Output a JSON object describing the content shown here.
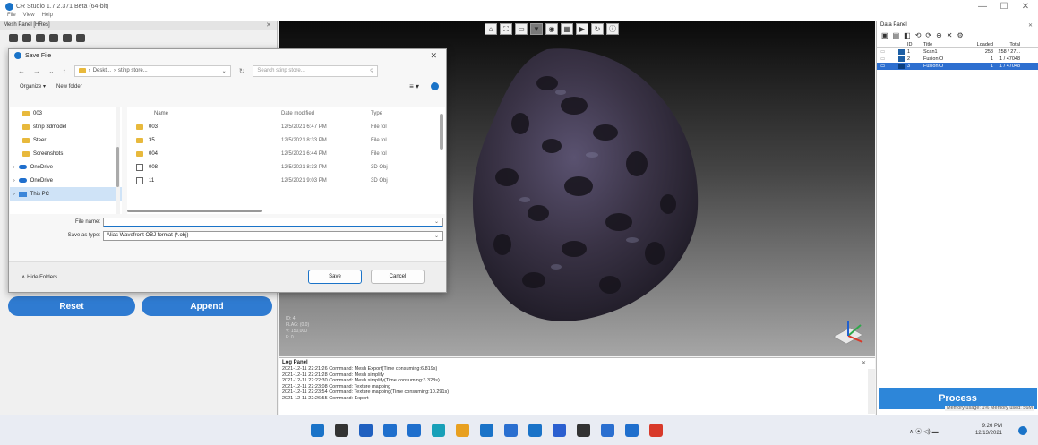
{
  "window": {
    "title": "CR Studio 1.7.2.371 Beta (64-bit)",
    "menu": [
      "File",
      "View",
      "Help"
    ],
    "minimize": "—",
    "maximize": "☐",
    "close": "✕"
  },
  "left_panel": {
    "title": "Mesh Panel [HRes]",
    "close": "✕",
    "reset_label": "Reset",
    "append_label": "Append"
  },
  "viewport": {
    "toolbar": [
      "⌂",
      "⛶",
      "▭",
      "▼",
      "◉",
      "▦",
      "▶",
      "↻",
      "ⓘ"
    ],
    "info_lines": [
      "ID: 4",
      "FLAG: (0.0)",
      "V: 150,000",
      "F: 0"
    ]
  },
  "log_panel": {
    "title": "Log Panel",
    "close": "✕",
    "lines": [
      "2021-12-11 22:21:26 Command: Mesh Export(Time consuming:6.819s)",
      "2021-12-11 22:21:28 Command: Mesh simplify",
      "2021-12-11 22:22:30 Command: Mesh simplify(Time consuming:3.328s)",
      "2021-12-11 22:23:08 Command: Texture mapping",
      "2021-12-11 22:23:54 Command: Texture mapping(Time consuming:10.291s)",
      "2021-12-11 22:26:55 Command: Export"
    ]
  },
  "data_panel": {
    "title": "Data Panel",
    "close": "✕",
    "icons": [
      "▣",
      "▤",
      "◧",
      "⟲",
      "⟳",
      "⊕",
      "✕",
      "⚙"
    ],
    "columns": [
      "ID",
      "Title",
      "Loaded",
      "Total"
    ],
    "rows": [
      {
        "id": "1",
        "title": "Scan1",
        "loaded": "258",
        "total": "258 / 27...",
        "selected": false
      },
      {
        "id": "2",
        "title": "Fusion O",
        "loaded": "1",
        "total": "1 / 47048",
        "selected": false
      },
      {
        "id": "3",
        "title": "Fusion O",
        "loaded": "1",
        "total": "1 / 47048",
        "selected": true
      }
    ],
    "process_label": "Process"
  },
  "dialog": {
    "title": "Save File",
    "close": "✕",
    "path": [
      "Deskt...",
      "stinp store..."
    ],
    "search_placeholder": "Search stinp store...",
    "organize_label": "Organize ▾",
    "new_folder_label": "New folder",
    "nav_items": [
      {
        "label": "003",
        "type": "folder",
        "selected": false
      },
      {
        "label": "stinp 3dmodel",
        "type": "folder",
        "selected": false
      },
      {
        "label": "Steer",
        "type": "folder",
        "selected": false
      },
      {
        "label": "Screenshots",
        "type": "folder",
        "selected": false
      },
      {
        "label": "OneDrive",
        "type": "cloud",
        "selected": false
      },
      {
        "label": "OneDrive",
        "type": "cloud",
        "selected": false
      },
      {
        "label": "This PC",
        "type": "pc",
        "selected": true
      }
    ],
    "file_columns": [
      "Name",
      "Date modified",
      "Type"
    ],
    "files": [
      {
        "name": "003",
        "date": "12/5/2021 6:47 PM",
        "type": "File fol",
        "kind": "folder"
      },
      {
        "name": "35",
        "date": "12/5/2021 8:33 PM",
        "type": "File fol",
        "kind": "folder"
      },
      {
        "name": "004",
        "date": "12/5/2021 6:44 PM",
        "type": "File fol",
        "kind": "folder"
      },
      {
        "name": "008",
        "date": "12/5/2021 8:33 PM",
        "type": "3D Obj",
        "kind": "file"
      },
      {
        "name": "11",
        "date": "12/5/2021 9:03 PM",
        "type": "3D Obj",
        "kind": "file"
      }
    ],
    "file_name_label": "File name:",
    "file_name_value": "",
    "save_type_label": "Save as type:",
    "save_type_value": "Alias Wavefront OBJ format (*.obj)",
    "hide_folders_label": "Hide Folders",
    "save_label": "Save",
    "cancel_label": "Cancel"
  },
  "statusbar": {
    "memory": "Memory usage: 1%   Memory used: 56M"
  },
  "taskbar": {
    "icon_colors": [
      "#1a73c8",
      "#333333",
      "#2060c0",
      "#1f6fcd",
      "#1f6fcd",
      "#18a0b8",
      "#e8a020",
      "#1a73c8",
      "#2a6fd0",
      "#1a73c8",
      "#2b5fd0",
      "#333333",
      "#2a6fd0",
      "#1f6fcd",
      "#d83a2a"
    ],
    "tray": "∧   ⦿ ◁) ▬",
    "time": "9:26 PM",
    "date": "12/13/2021"
  }
}
